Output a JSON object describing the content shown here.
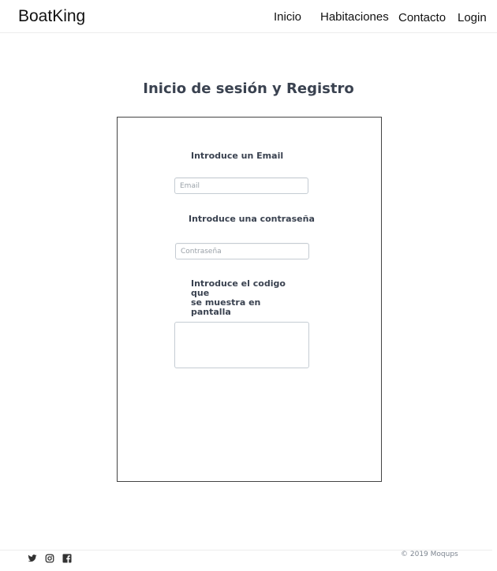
{
  "navbar": {
    "brand": "BoatKing",
    "links": [
      {
        "label": "Inicio"
      },
      {
        "label": "Habitaciones"
      },
      {
        "label": "Contacto"
      },
      {
        "label": "Login"
      }
    ]
  },
  "main": {
    "title": "Inicio de sesión y Registro",
    "form": {
      "email_label": "Introduce un Email",
      "email_placeholder": "Email",
      "email_value": "",
      "password_label": "Introduce una contraseña",
      "password_placeholder": "Contraseña",
      "password_value": "",
      "code_label_line1": "Introduce el codigo que",
      "code_label_line2": "se muestra en pantalla",
      "code_value": ""
    }
  },
  "footer": {
    "social_icons": [
      "twitter-icon",
      "instagram-icon",
      "facebook-icon"
    ],
    "copyright": "© 2019  Moqups"
  },
  "colors": {
    "heading": "#3a4250",
    "input_border": "#c5ccd3",
    "box_border": "#444444",
    "footer_text": "#7d8590"
  }
}
